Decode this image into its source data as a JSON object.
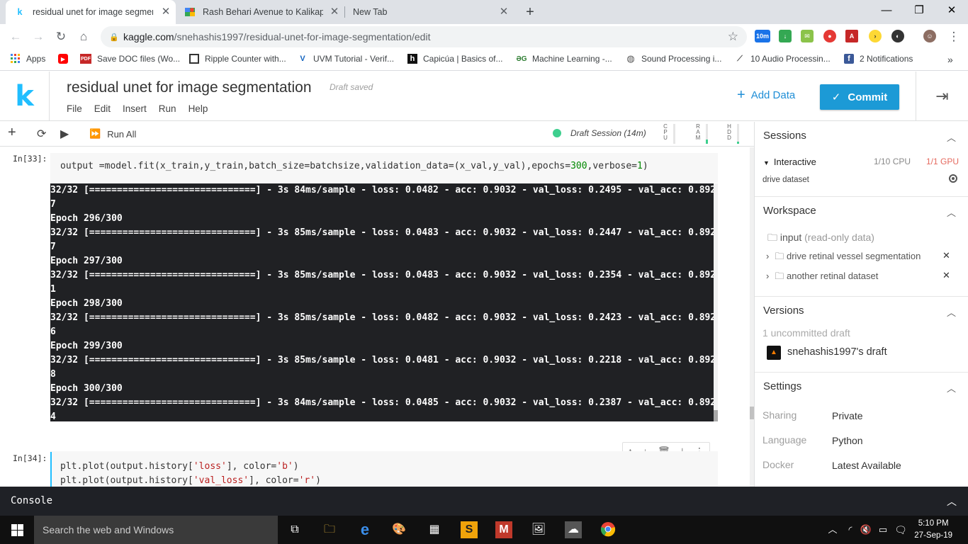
{
  "browser": {
    "tabs": [
      {
        "title": "residual unet for image segmentation",
        "favicon": "kaggle-k"
      },
      {
        "title": "Rash Behari Avenue to Kalikapur",
        "favicon": "maps"
      },
      {
        "title": "New Tab",
        "favicon": ""
      }
    ],
    "url_domain": "kaggle.com",
    "url_path": "/snehashis1997/residual-unet-for-image-segmentation/edit",
    "extension_badge": "10m",
    "bookmarks": [
      {
        "label": "Apps",
        "icon": "apps-grid"
      },
      {
        "label": "",
        "icon": "youtube"
      },
      {
        "label": "Save DOC files (Wo...",
        "icon": "pdf"
      },
      {
        "label": "Ripple Counter with...",
        "icon": "square"
      },
      {
        "label": "UVM Tutorial - Verif...",
        "icon": "v-mark"
      },
      {
        "label": "Capicúa | Basics of...",
        "icon": "h-square"
      },
      {
        "label": "Machine Learning -...",
        "icon": "gg"
      },
      {
        "label": "Sound Processing i...",
        "icon": "globe"
      },
      {
        "label": "10 Audio Processin...",
        "icon": "chart-line"
      },
      {
        "label": "2 Notifications",
        "icon": "facebook"
      }
    ]
  },
  "kaggle": {
    "title": "residual unet for image segmentation",
    "draft_status": "Draft saved",
    "menu": [
      "File",
      "Edit",
      "Insert",
      "Run",
      "Help"
    ],
    "add_data": "Add Data",
    "commit": "Commit"
  },
  "toolbar": {
    "run_all": "Run All",
    "session": "Draft Session (14m)",
    "meters": [
      {
        "label": "CPU",
        "level": 0
      },
      {
        "label": "RAM",
        "level": 0.2
      },
      {
        "label": "HDD",
        "level": 0.1
      }
    ]
  },
  "cells": [
    {
      "prompt": "In[33]:",
      "code_parts": [
        "output =model.fit(x_train,y_train,batch_size=batchsize,validation_data=(x_val,y_val),epochs=",
        "300",
        ",verbose=",
        "1",
        ")"
      ],
      "output_lines": [
        "32/32 [==============================] - 3s 84ms/sample - loss: 0.0482 - acc: 0.9032 - val_loss: 0.2495 - val_acc: 0.892",
        "7",
        "Epoch 296/300",
        "32/32 [==============================] - 3s 85ms/sample - loss: 0.0483 - acc: 0.9032 - val_loss: 0.2447 - val_acc: 0.892",
        "7",
        "Epoch 297/300",
        "32/32 [==============================] - 3s 85ms/sample - loss: 0.0483 - acc: 0.9032 - val_loss: 0.2354 - val_acc: 0.892",
        "1",
        "Epoch 298/300",
        "32/32 [==============================] - 3s 85ms/sample - loss: 0.0482 - acc: 0.9032 - val_loss: 0.2423 - val_acc: 0.892",
        "6",
        "Epoch 299/300",
        "32/32 [==============================] - 3s 85ms/sample - loss: 0.0481 - acc: 0.9032 - val_loss: 0.2218 - val_acc: 0.892",
        "8",
        "Epoch 300/300",
        "32/32 [==============================] - 3s 84ms/sample - loss: 0.0485 - acc: 0.9032 - val_loss: 0.2387 - val_acc: 0.892",
        "4"
      ]
    },
    {
      "prompt": "In[34]:",
      "line1": [
        "plt.plot(output.history[",
        "'loss'",
        "], color=",
        "'b'",
        ")"
      ],
      "line2": [
        "plt.plot(output.history[",
        "'val_loss'",
        "], color=",
        "'r'",
        ")"
      ]
    }
  ],
  "sidebar": {
    "sessions": {
      "header": "Sessions",
      "type": "Interactive",
      "cpu": "1/10 CPU",
      "gpu": "1/1 GPU",
      "dataset": "drive dataset"
    },
    "workspace": {
      "header": "Workspace",
      "input_label": "input",
      "input_note": "(read-only data)",
      "items": [
        "drive retinal vessel segmentation",
        "another retinal dataset"
      ]
    },
    "versions": {
      "header": "Versions",
      "uncommitted": "1 uncommitted draft",
      "draft": "snehashis1997's draft"
    },
    "settings": {
      "header": "Settings",
      "rows": [
        {
          "label": "Sharing",
          "value": "Private"
        },
        {
          "label": "Language",
          "value": "Python"
        },
        {
          "label": "Docker",
          "value": "Latest Available"
        }
      ]
    }
  },
  "console": {
    "label": "Console"
  },
  "taskbar": {
    "search_placeholder": "Search the web and Windows",
    "time": "5:10 PM",
    "date": "27-Sep-19"
  },
  "colors": {
    "kaggle_blue": "#20beff",
    "commit_blue": "#1c9ad6",
    "session_green": "#3ecf8e",
    "gpu_red": "#e56a5f"
  }
}
